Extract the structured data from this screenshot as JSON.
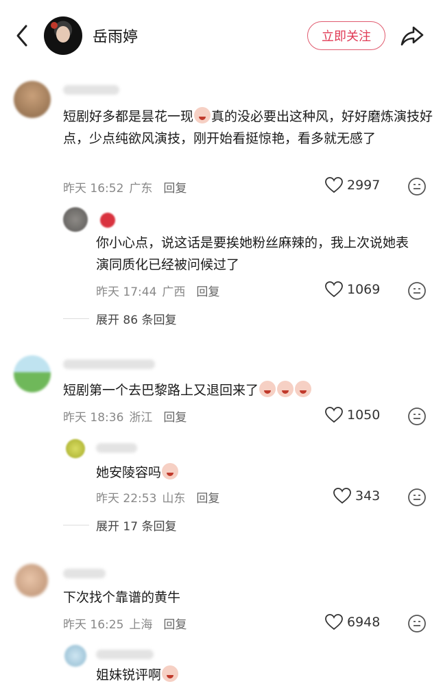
{
  "header": {
    "username": "岳雨婷",
    "follow_label": "立即关注"
  },
  "comments": [
    {
      "text": "短剧好多都是昙花一现",
      "text_after_emoji": "真的没必要出这种风，好好磨炼演技好点，少点纯欲风演技，刚开始看挺惊艳，看多就无感了",
      "time": "昨天 16:52",
      "region": "广东",
      "reply": "回复",
      "likes": "2997"
    },
    {
      "text": "你小心点，说这话是要挨她粉丝麻辣的，我上次说她表演同质化已经被问候过了",
      "time": "昨天 17:44",
      "region": "广西",
      "reply": "回复",
      "likes": "1069",
      "expand": "展开 86 条回复"
    },
    {
      "text": "短剧第一个去巴黎路上又退回来了",
      "time": "昨天 18:36",
      "region": "浙江",
      "reply": "回复",
      "likes": "1050"
    },
    {
      "text": "她安陵容吗",
      "time": "昨天 22:53",
      "region": "山东",
      "reply": "回复",
      "likes": "343",
      "expand": "展开 17 条回复"
    },
    {
      "text": "下次找个靠谱的黄牛",
      "time": "昨天 16:25",
      "region": "上海",
      "reply": "回复",
      "likes": "6948"
    },
    {
      "text": "姐妹锐评啊"
    }
  ],
  "colors": {
    "accent": "#e03a55",
    "meta": "#888888"
  }
}
